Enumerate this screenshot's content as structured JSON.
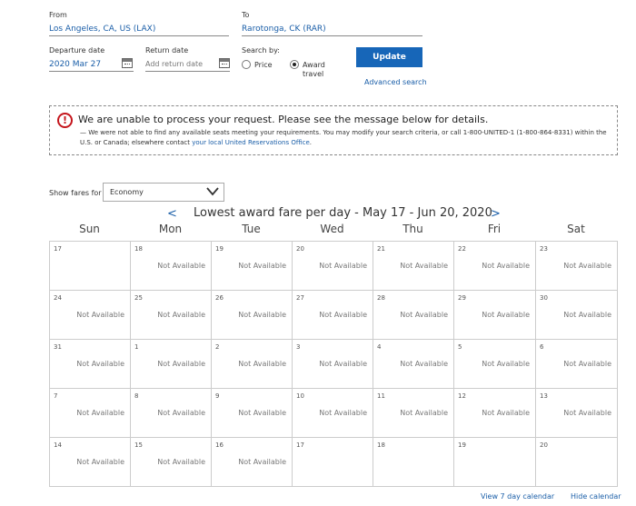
{
  "search": {
    "from_label": "From",
    "from_value": "Los Angeles, CA, US (LAX)",
    "to_label": "To",
    "to_value": "Rarotonga, CK (RAR)",
    "departure_label": "Departure date",
    "departure_value": "2020 Mar 27",
    "return_label": "Return date",
    "return_placeholder": "Add return date",
    "search_by_label": "Search by:",
    "option_price": "Price",
    "option_award_line1": "Award",
    "option_award_line2": "travel",
    "selected_option": "award",
    "update_label": "Update",
    "advanced_label": "Advanced search"
  },
  "alert": {
    "title": "We are unable to process your request. Please see the message below for details.",
    "message": "— We were not able to find any available seats meeting your requirements. You may modify your search criteria, or call 1-800-UNITED-1 (1-800-864-8331) within the U.S. or Canada; elsewhere contact",
    "link": "your local United Reservations Office",
    "message_end": "."
  },
  "fares": {
    "label": "Show fares for",
    "selected": "Economy"
  },
  "calendar": {
    "title": "Lowest award fare per day - May 17 - Jun 20, 2020",
    "prev": "<",
    "next": ">",
    "weekdays": [
      "Sun",
      "Mon",
      "Tue",
      "Wed",
      "Thu",
      "Fri",
      "Sat"
    ],
    "weeks": [
      [
        {
          "day": "17",
          "fare": ""
        },
        {
          "day": "18",
          "fare": "Not Available"
        },
        {
          "day": "19",
          "fare": "Not Available"
        },
        {
          "day": "20",
          "fare": "Not Available"
        },
        {
          "day": "21",
          "fare": "Not Available"
        },
        {
          "day": "22",
          "fare": "Not Available"
        },
        {
          "day": "23",
          "fare": "Not Available"
        }
      ],
      [
        {
          "day": "24",
          "fare": "Not Available"
        },
        {
          "day": "25",
          "fare": "Not Available"
        },
        {
          "day": "26",
          "fare": "Not Available"
        },
        {
          "day": "27",
          "fare": "Not Available"
        },
        {
          "day": "28",
          "fare": "Not Available"
        },
        {
          "day": "29",
          "fare": "Not Available"
        },
        {
          "day": "30",
          "fare": "Not Available"
        }
      ],
      [
        {
          "day": "31",
          "fare": "Not Available"
        },
        {
          "day": "1",
          "fare": "Not Available"
        },
        {
          "day": "2",
          "fare": "Not Available"
        },
        {
          "day": "3",
          "fare": "Not Available"
        },
        {
          "day": "4",
          "fare": "Not Available"
        },
        {
          "day": "5",
          "fare": "Not Available"
        },
        {
          "day": "6",
          "fare": "Not Available"
        }
      ],
      [
        {
          "day": "7",
          "fare": "Not Available"
        },
        {
          "day": "8",
          "fare": "Not Available"
        },
        {
          "day": "9",
          "fare": "Not Available"
        },
        {
          "day": "10",
          "fare": "Not Available"
        },
        {
          "day": "11",
          "fare": "Not Available"
        },
        {
          "day": "12",
          "fare": "Not Available"
        },
        {
          "day": "13",
          "fare": "Not Available"
        }
      ],
      [
        {
          "day": "14",
          "fare": "Not Available"
        },
        {
          "day": "15",
          "fare": "Not Available"
        },
        {
          "day": "16",
          "fare": "Not Available"
        },
        {
          "day": "17",
          "fare": ""
        },
        {
          "day": "18",
          "fare": ""
        },
        {
          "day": "19",
          "fare": ""
        },
        {
          "day": "20",
          "fare": ""
        }
      ]
    ],
    "view7_label": "View 7 day calendar",
    "hide_label": "Hide calendar"
  },
  "colors": {
    "link": "#1a5ea8",
    "button": "#1766b8",
    "alert_icon": "#c5161d"
  },
  "icons": {
    "alert": "exclamation-circle-icon",
    "calendar": "calendar-icon",
    "dropdown": "chevron-down-icon"
  }
}
